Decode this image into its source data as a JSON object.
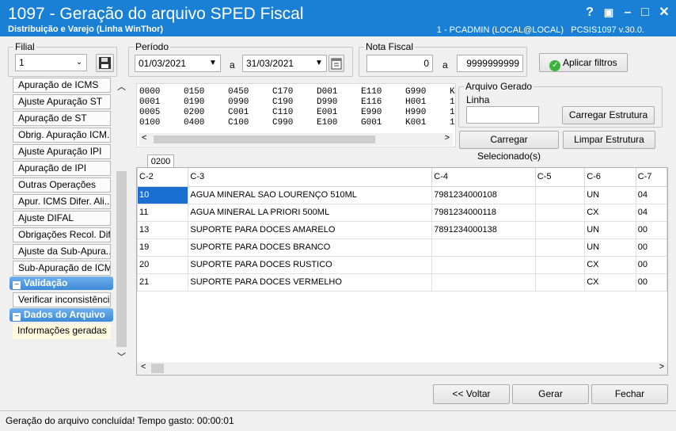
{
  "window": {
    "title": "1097 - Geração do arquivo SPED Fiscal",
    "subtitle": "Distribuição e Varejo (Linha WinThor)",
    "user_info": "1 - PCADMIN (LOCAL@LOCAL)",
    "version": "PCSIS1097  v.30.0.",
    "controls": [
      "?",
      "▣",
      "–",
      "□",
      "✕"
    ]
  },
  "filters": {
    "filial_label": "Filial",
    "filial_value": "1",
    "periodo_label": "Período",
    "date_from": "01/03/2021",
    "date_sep": "a",
    "date_to": "31/03/2021",
    "nota_label": "Nota Fiscal",
    "nota_from": "0",
    "nota_sep": "a",
    "nota_to": "9999999999",
    "apply_label": "Aplicar filtros"
  },
  "sidebar": {
    "items": [
      "Apuração de ICMS",
      "Ajuste Apuração ST",
      "Apuração de ST",
      "Obrig. Apuração ICM...",
      "Ajuste Apuração IPI",
      "Apuração de IPI",
      "Outras Operações",
      "Apur. ICMS Difer. Ali...",
      "Ajuste DIFAL",
      "Obrigações Recol. Difal",
      "Ajuste da Sub-Apura...",
      "Sub-Apuração de ICMS"
    ],
    "section_validacao": "Validação",
    "validacao_items": [
      "Verificar inconsistências"
    ],
    "section_dados": "Dados do Arquivo",
    "dados_items": [
      "Informações geradas"
    ]
  },
  "registers": {
    "rows": [
      [
        "0000",
        "0150",
        "0450",
        "C170",
        "D001",
        "E110",
        "G990",
        "K"
      ],
      [
        "0001",
        "0190",
        "0990",
        "C190",
        "D990",
        "E116",
        "H001",
        "1"
      ],
      [
        "0005",
        "0200",
        "C001",
        "C110",
        "E001",
        "E990",
        "H990",
        "1"
      ],
      [
        "0100",
        "0400",
        "C100",
        "C990",
        "E100",
        "G001",
        "K001",
        "1"
      ]
    ]
  },
  "arquivo": {
    "label": "Arquivo Gerado",
    "linha_label": "Linha",
    "linha_value": "",
    "load_structure": "Carregar Estrutura",
    "load_selected": "Carregar Selecionado(s)",
    "clear_structure": "Limpar Estrutura"
  },
  "tab": {
    "label": "0200"
  },
  "table": {
    "headers": [
      "C-2",
      "C-3",
      "C-4",
      "C-5",
      "C-6",
      "C-7"
    ],
    "rows": [
      [
        "10",
        "AGUA MINERAL SAO LOURENÇO 510ML",
        "7981234000108",
        "",
        "UN",
        "04"
      ],
      [
        "11",
        "AGUA MINERAL LA PRIORI 500ML",
        "7981234000118",
        "",
        "CX",
        "04"
      ],
      [
        "13",
        "SUPORTE PARA DOCES AMARELO",
        "7891234000138",
        "",
        "UN",
        "00"
      ],
      [
        "19",
        "SUPORTE PARA DOCES BRANCO",
        "",
        "",
        "UN",
        "00"
      ],
      [
        "20",
        "SUPORTE PARA DOCES RUSTICO",
        "",
        "",
        "CX",
        "00"
      ],
      [
        "21",
        "SUPORTE PARA DOCES VERMELHO",
        "",
        "",
        "CX",
        "00"
      ]
    ]
  },
  "footer": {
    "back": "<< Voltar",
    "generate": "Gerar",
    "close": "Fechar"
  },
  "status": "Geração do arquivo concluída! Tempo gasto: 00:00:01"
}
